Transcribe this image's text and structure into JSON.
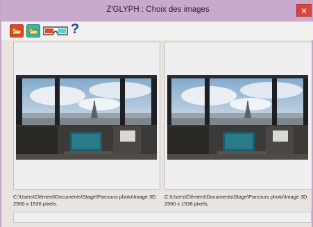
{
  "window": {
    "title": "Z'GLYPH : Choix des images",
    "close_glyph": "✕"
  },
  "toolbar": {
    "help_glyph": "?",
    "buttons": [
      {
        "icon": "open-left-folder-icon",
        "color": "#e8432e"
      },
      {
        "icon": "open-right-folder-icon",
        "color": "#2dbda3"
      },
      {
        "icon": "anaglyph-glasses-icon",
        "color": "#e8432e"
      }
    ]
  },
  "images": {
    "left": {
      "path": "C:\\Users\\Clément\\Documents\\Stage\\Parcours photo\\Image 3D",
      "size": "2560 x 1536 pixels."
    },
    "right": {
      "path": "C:\\Users\\Clément\\Documents\\Stage\\Parcours photo\\Image 3D",
      "size": "2560 x 1536 pixels."
    }
  }
}
